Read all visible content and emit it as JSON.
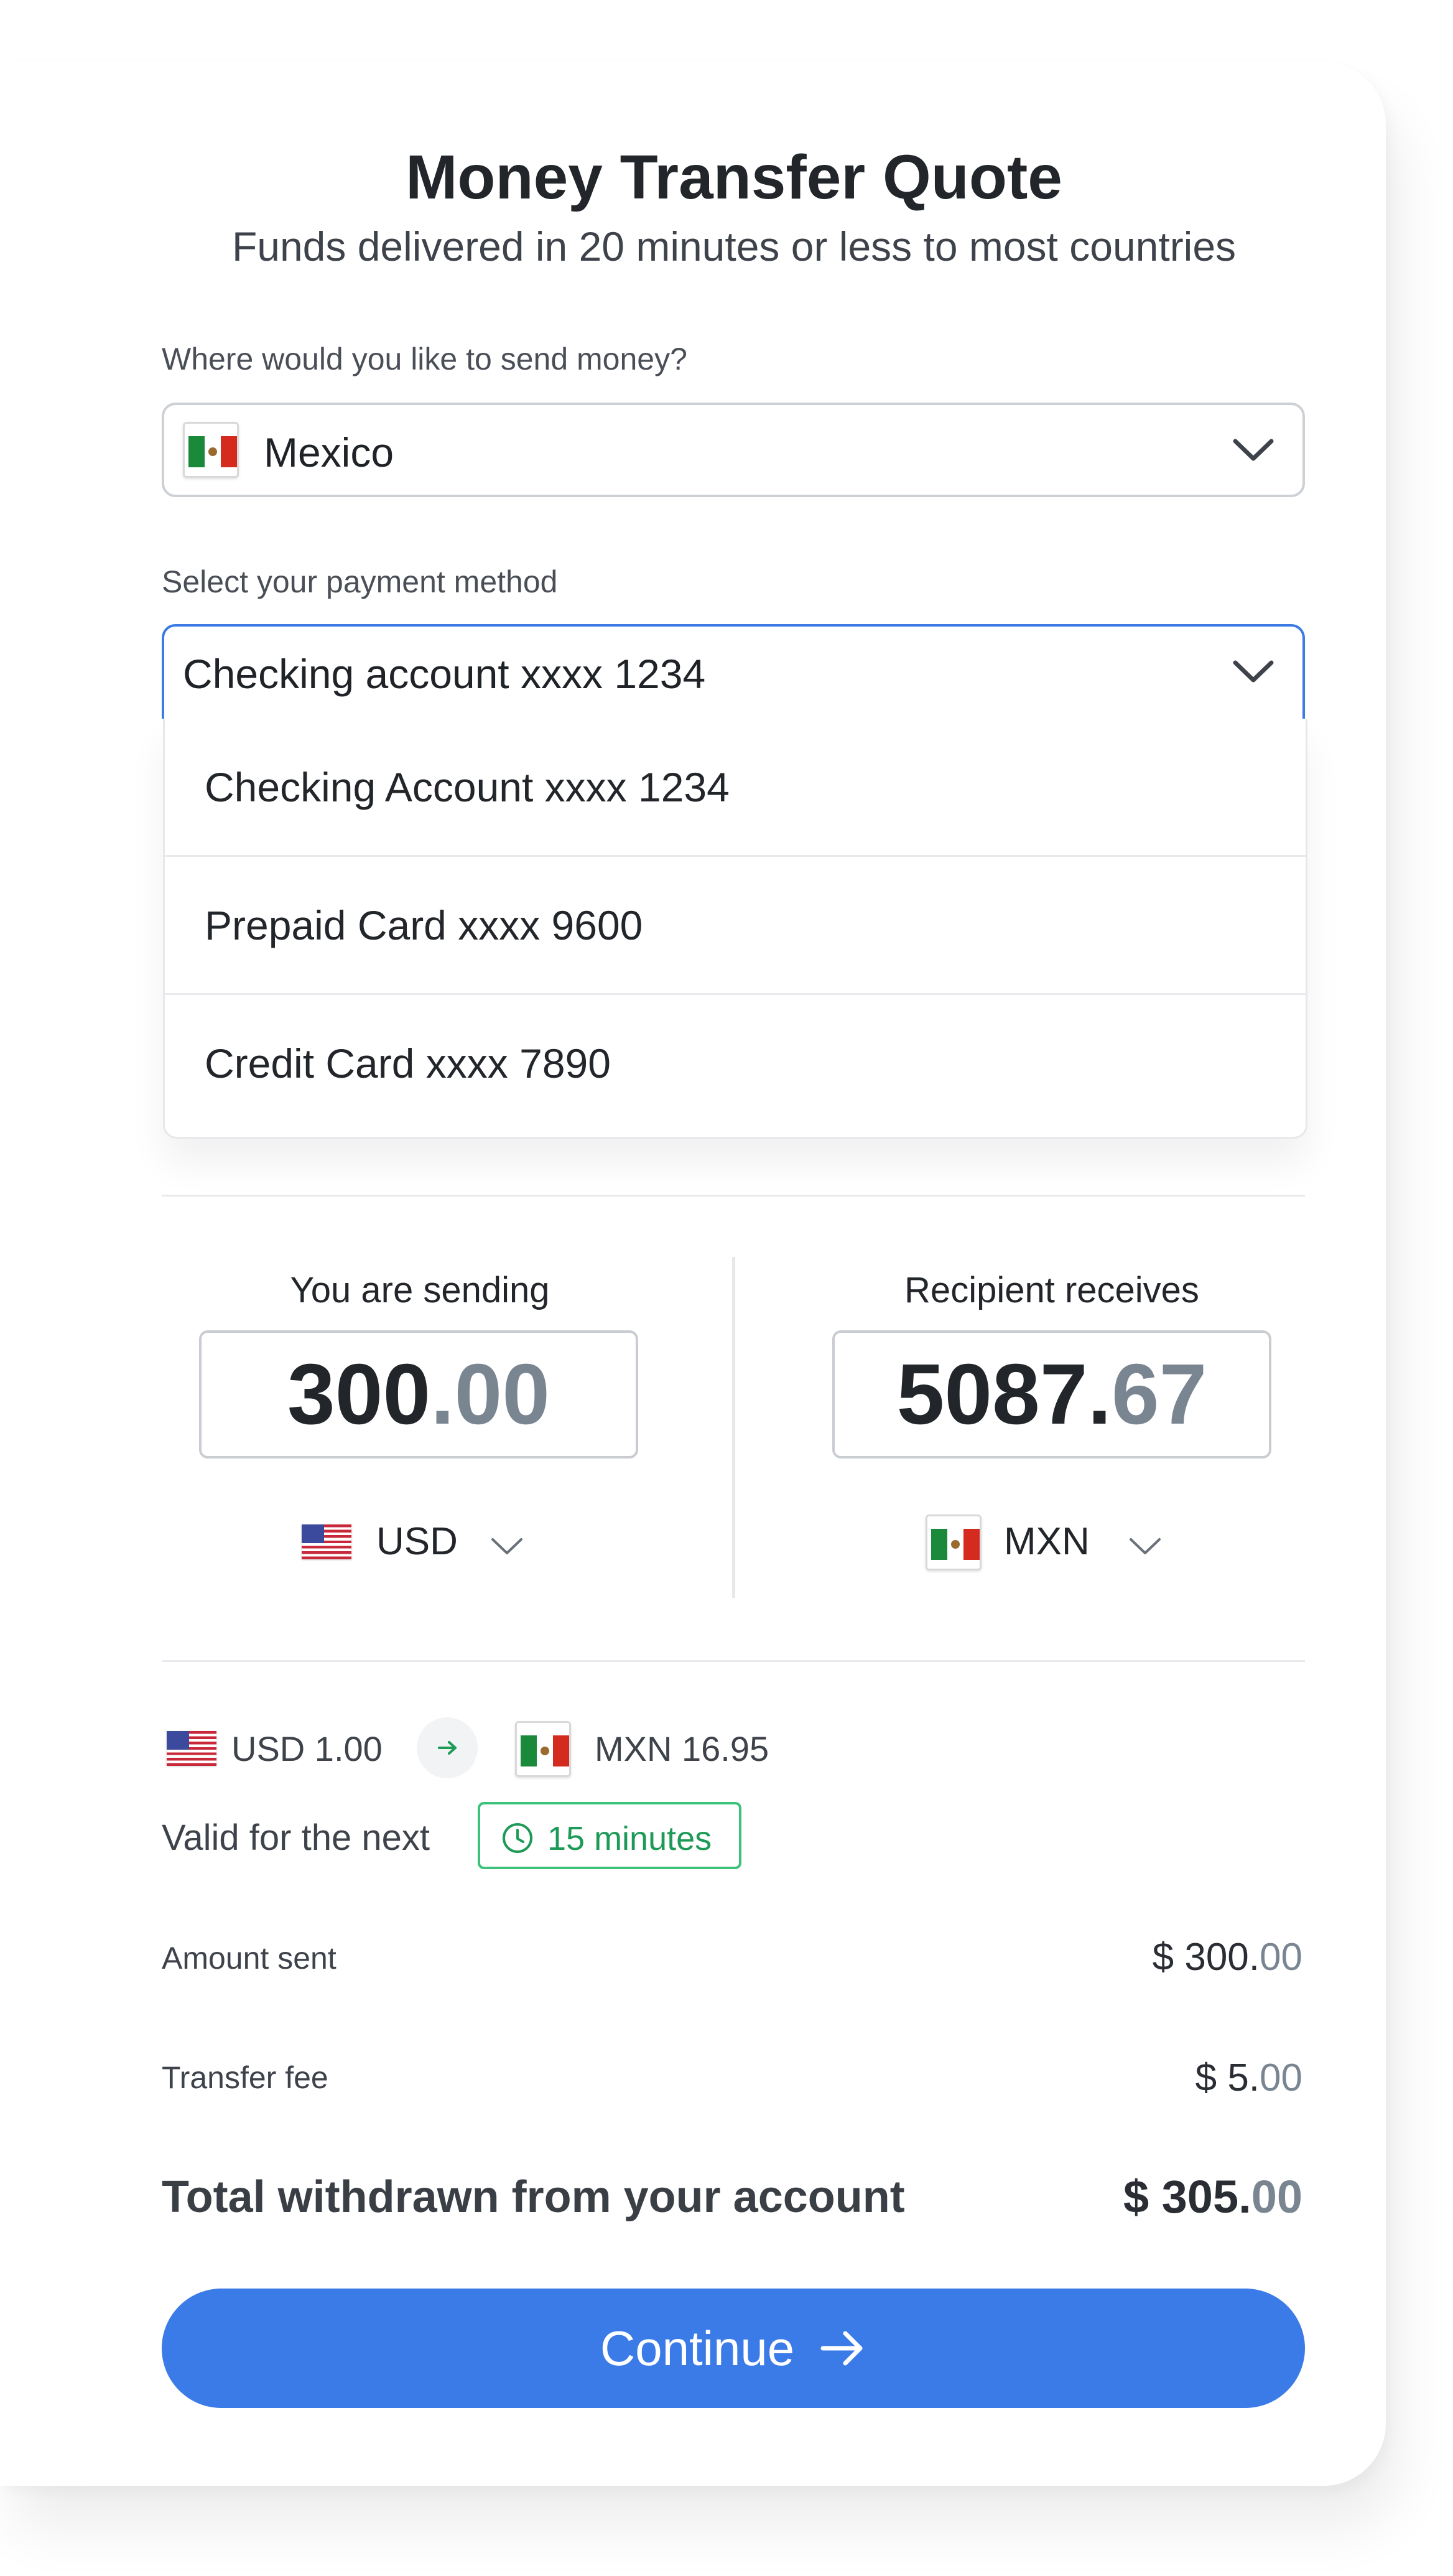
{
  "header": {
    "title": "Money Transfer Quote",
    "subtitle": "Funds delivered in 20 minutes or less to most countries"
  },
  "destination": {
    "label": "Where would you like to send money?",
    "selected": "Mexico",
    "flag": "mexico-flag-icon"
  },
  "payment": {
    "label": "Select your payment method",
    "selected": "Checking account xxxx 1234",
    "options": [
      "Checking Account xxxx 1234",
      "Prepaid Card xxxx 9600",
      "Credit Card xxxx 7890"
    ]
  },
  "sending": {
    "label": "You are sending",
    "whole": "300",
    "decimal": ".00",
    "currency": "USD",
    "flag": "usa-flag-icon"
  },
  "receiving": {
    "label": "Recipient receives",
    "whole": "5087.",
    "decimal": "67",
    "currency": "MXN",
    "flag": "mexico-flag-icon"
  },
  "rate": {
    "from": "USD 1.00",
    "to": "MXN 16.95",
    "valid_label": "Valid for the next",
    "valid_badge": "15 minutes"
  },
  "summary": {
    "amount_sent_label": "Amount sent",
    "amount_sent_whole": "$ 300.",
    "amount_sent_decimal": "00",
    "fee_label": "Transfer fee",
    "fee_whole": "$ 5.",
    "fee_decimal": "00",
    "total_label": "Total withdrawn from your account",
    "total_whole": "$ 305.",
    "total_decimal": "00"
  },
  "actions": {
    "continue_label": "Continue"
  },
  "colors": {
    "accent": "#3b7be8",
    "badge_green": "#1e9a57",
    "decimal_grey": "#7a8592"
  }
}
